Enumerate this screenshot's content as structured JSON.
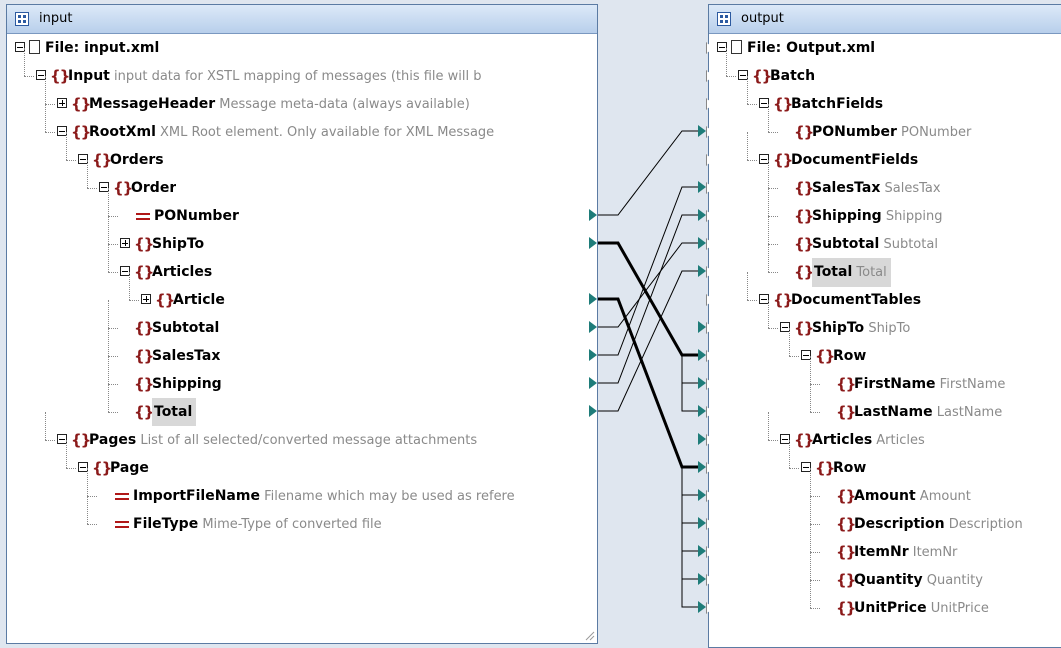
{
  "input": {
    "title": "input",
    "rows": [
      {
        "label": "File: input.xml",
        "desc": "",
        "kind": "file",
        "expand": "minus",
        "level": 0,
        "port": "empty"
      },
      {
        "label": "Input",
        "desc": "input data for XSTL mapping of messages (this file will b",
        "kind": "element",
        "expand": "minus",
        "level": 1,
        "port": "empty"
      },
      {
        "label": "MessageHeader",
        "desc": "Message meta-data (always available)",
        "kind": "element",
        "expand": "plus",
        "level": 2,
        "port": "empty"
      },
      {
        "label": "RootXml",
        "desc": "XML Root element. Only available for XML Message",
        "kind": "element",
        "expand": "minus",
        "level": 2,
        "port": "empty"
      },
      {
        "label": "Orders",
        "desc": "",
        "kind": "element",
        "expand": "minus",
        "level": 3,
        "port": "empty"
      },
      {
        "label": "Order",
        "desc": "",
        "kind": "element",
        "expand": "minus",
        "level": 4,
        "port": "empty"
      },
      {
        "label": "PONumber",
        "desc": "",
        "kind": "attribute",
        "expand": "none",
        "level": 5,
        "port": "filled"
      },
      {
        "label": "ShipTo",
        "desc": "",
        "kind": "element",
        "expand": "plus",
        "level": 5,
        "port": "filled"
      },
      {
        "label": "Articles",
        "desc": "",
        "kind": "element",
        "expand": "minus",
        "level": 5,
        "port": "empty"
      },
      {
        "label": "Article",
        "desc": "",
        "kind": "element",
        "expand": "plus",
        "level": 6,
        "port": "filled"
      },
      {
        "label": "Subtotal",
        "desc": "",
        "kind": "element",
        "expand": "none",
        "level": 5,
        "port": "filled"
      },
      {
        "label": "SalesTax",
        "desc": "",
        "kind": "element",
        "expand": "none",
        "level": 5,
        "port": "filled"
      },
      {
        "label": "Shipping",
        "desc": "",
        "kind": "element",
        "expand": "none",
        "level": 5,
        "port": "filled"
      },
      {
        "label": "Total",
        "desc": "",
        "kind": "element",
        "expand": "none",
        "level": 5,
        "port": "filled",
        "highlight": true
      },
      {
        "label": "Pages",
        "desc": "List of all selected/converted message attachments",
        "kind": "element",
        "expand": "minus",
        "level": 2,
        "port": "empty"
      },
      {
        "label": "Page",
        "desc": "",
        "kind": "element",
        "expand": "minus",
        "level": 3,
        "port": "empty"
      },
      {
        "label": "ImportFileName",
        "desc": "Filename which may be used as refere",
        "kind": "attribute",
        "expand": "none",
        "level": 4,
        "port": "empty"
      },
      {
        "label": "FileType",
        "desc": "Mime-Type of converted file",
        "kind": "attribute",
        "expand": "none",
        "level": 4,
        "port": "empty"
      }
    ]
  },
  "output": {
    "title": "output",
    "rows": [
      {
        "label": "File: Output.xml",
        "desc": "",
        "kind": "file",
        "expand": "minus",
        "level": 0,
        "port": "empty"
      },
      {
        "label": "Batch",
        "desc": "",
        "kind": "element",
        "expand": "minus",
        "level": 1,
        "port": "empty"
      },
      {
        "label": "BatchFields",
        "desc": "",
        "kind": "element",
        "expand": "minus",
        "level": 2,
        "port": "empty"
      },
      {
        "label": "PONumber",
        "desc": "PONumber",
        "kind": "element",
        "expand": "none",
        "level": 3,
        "port": "filled"
      },
      {
        "label": "DocumentFields",
        "desc": "",
        "kind": "element",
        "expand": "minus",
        "level": 2,
        "port": "empty"
      },
      {
        "label": "SalesTax",
        "desc": "SalesTax",
        "kind": "element",
        "expand": "none",
        "level": 3,
        "port": "filled"
      },
      {
        "label": "Shipping",
        "desc": "Shipping",
        "kind": "element",
        "expand": "none",
        "level": 3,
        "port": "filled"
      },
      {
        "label": "Subtotal",
        "desc": "Subtotal",
        "kind": "element",
        "expand": "none",
        "level": 3,
        "port": "filled"
      },
      {
        "label": "Total",
        "desc": "Total",
        "kind": "element",
        "expand": "none",
        "level": 3,
        "port": "filled",
        "highlight": true
      },
      {
        "label": "DocumentTables",
        "desc": "",
        "kind": "element",
        "expand": "minus",
        "level": 2,
        "port": "empty"
      },
      {
        "label": "ShipTo",
        "desc": "ShipTo",
        "kind": "element",
        "expand": "minus",
        "level": 3,
        "port": "filled"
      },
      {
        "label": "Row",
        "desc": "",
        "kind": "element",
        "expand": "minus",
        "level": 4,
        "port": "filled"
      },
      {
        "label": "FirstName",
        "desc": "FirstName",
        "kind": "element",
        "expand": "none",
        "level": 5,
        "port": "filled"
      },
      {
        "label": "LastName",
        "desc": "LastName",
        "kind": "element",
        "expand": "none",
        "level": 5,
        "port": "filled"
      },
      {
        "label": "Articles",
        "desc": "Articles",
        "kind": "element",
        "expand": "minus",
        "level": 3,
        "port": "filled"
      },
      {
        "label": "Row",
        "desc": "",
        "kind": "element",
        "expand": "minus",
        "level": 4,
        "port": "filled"
      },
      {
        "label": "Amount",
        "desc": "Amount",
        "kind": "element",
        "expand": "none",
        "level": 5,
        "port": "filled"
      },
      {
        "label": "Description",
        "desc": "Description",
        "kind": "element",
        "expand": "none",
        "level": 5,
        "port": "filled"
      },
      {
        "label": "ItemNr",
        "desc": "ItemNr",
        "kind": "element",
        "expand": "none",
        "level": 5,
        "port": "filled"
      },
      {
        "label": "Quantity",
        "desc": "Quantity",
        "kind": "element",
        "expand": "none",
        "level": 5,
        "port": "filled"
      },
      {
        "label": "UnitPrice",
        "desc": "UnitPrice",
        "kind": "element",
        "expand": "none",
        "level": 5,
        "port": "filled"
      }
    ]
  },
  "connections": [
    {
      "from": 6,
      "to": 3,
      "bold": false
    },
    {
      "from": 7,
      "to": 11,
      "bold": true
    },
    {
      "from": 9,
      "to": 15,
      "bold": true
    },
    {
      "from": 10,
      "to": 7,
      "bold": false
    },
    {
      "from": 11,
      "to": 5,
      "bold": false
    },
    {
      "from": 12,
      "to": 6,
      "bold": false
    },
    {
      "from": 13,
      "to": 8,
      "bold": false
    }
  ],
  "colors": {
    "accent": "#1e7c79",
    "element_icon": "#8b1a1a",
    "desc_text": "#8a8a8a",
    "titlebar": "#b8cfeb"
  }
}
